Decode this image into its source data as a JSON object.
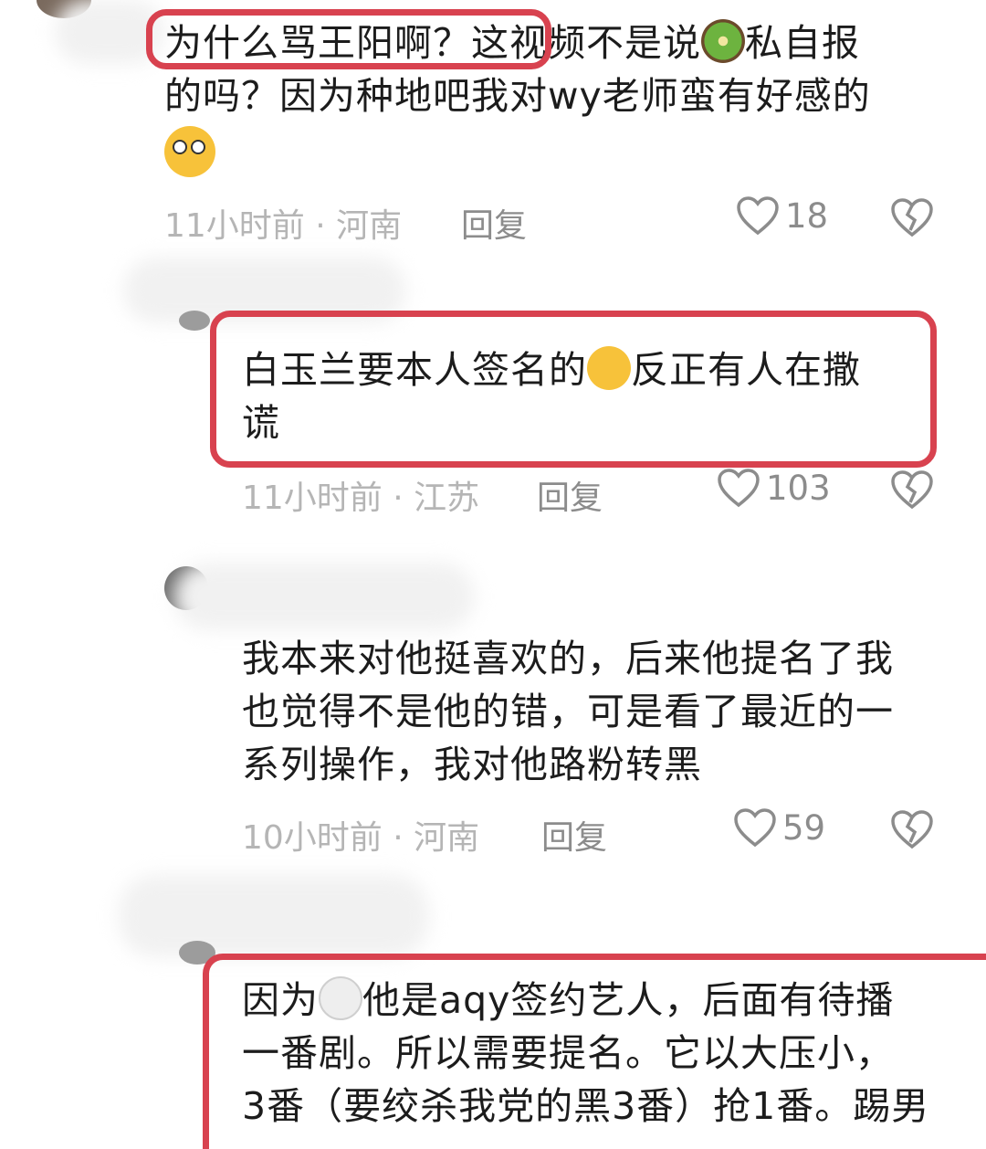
{
  "comments": [
    {
      "text": "为什么骂王阳啊？这视频不是说🥝私自报的吗？因为种地吧我对wy老师蛮有好感的😳",
      "line1": "为什么骂王阳啊？这视频不是说",
      "line1b": "私自报",
      "line2": "的吗？因为种地吧我对wy老师蛮有好感的",
      "meta": "11小时前 · 河南",
      "reply": "回复",
      "likes": "18"
    },
    {
      "text": "白玉兰要本人签名的🤣反正有人在撒谎",
      "line1": "白玉兰要本人签名的",
      "line1b": "反正有人在撒",
      "line2": "谎",
      "meta": "11小时前 · 江苏",
      "reply": "回复",
      "likes": "103"
    },
    {
      "text": "我本来对他挺喜欢的，后来他提名了我也觉得不是他的错，可是看了最近的一系列操作，我对他路粉转黑",
      "line1": "我本来对他挺喜欢的，后来他提名了我",
      "line2": "也觉得不是他的错，可是看了最近的一",
      "line3": "系列操作，我对他路粉转黑",
      "meta": "10小时前 · 河南",
      "reply": "回复",
      "likes": "59"
    },
    {
      "text": "因为🐑他是aqy签约艺人，后面有待播一番剧。所以需要提名。它以大压小，3番（要绞杀我党的黑3番）抢1番。踢男",
      "line1a": "因为",
      "line1b": "他是aqy签约艺人，后面有待播",
      "line2": "一番剧。所以需要提名。它以大压小，",
      "line3": "3番（要绞杀我党的黑3番）抢1番。踢男"
    }
  ],
  "icons": {
    "like": "heart-outline-icon",
    "dislike": "broken-heart-icon"
  },
  "colors": {
    "highlight": "#d8424f",
    "meta": "#b5b5b5",
    "action": "#8c8c8c"
  }
}
